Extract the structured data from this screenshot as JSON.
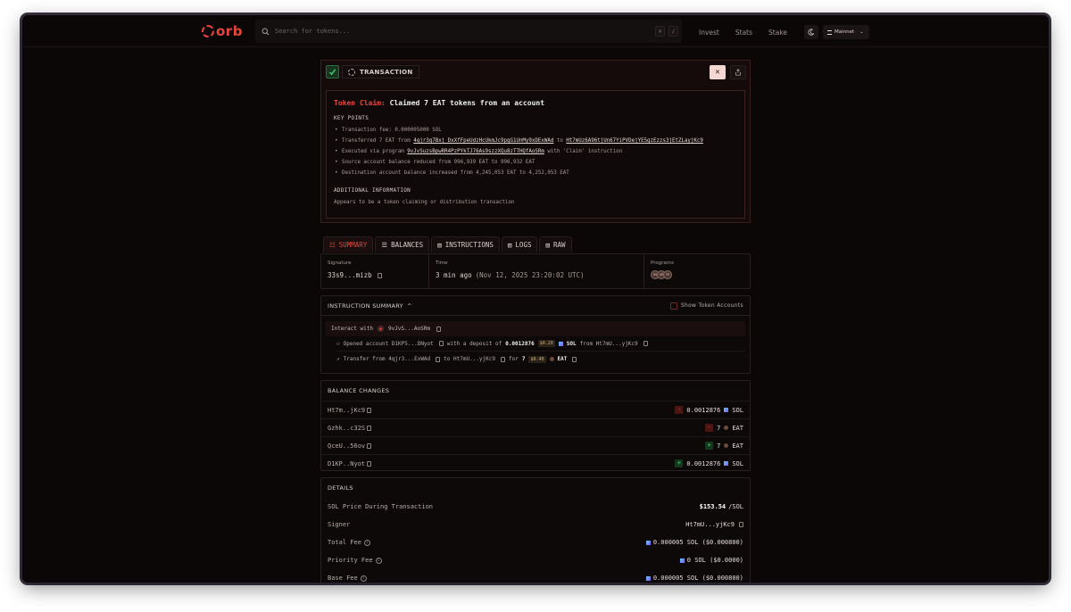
{
  "nav": {
    "logo": "orb",
    "search_placeholder": "Search for tokens...",
    "kbd1": "⌘",
    "kbd2": "/",
    "links": [
      "Invest",
      "Stats",
      "Stake"
    ],
    "network": "Mainnet"
  },
  "tx": {
    "tag": "TRANSACTION",
    "status_icon": "check-icon",
    "close_label": "✕",
    "summary_prefix": "Token Claim:",
    "summary_text": "Claimed 7 EAT tokens from an account",
    "key_points_label": "KEY POINTS",
    "bullets": [
      {
        "pre": "Transaction fee: 0.000005000 SOL",
        "link1": "",
        "mid": "",
        "link2": "",
        "post": ""
      },
      {
        "pre": "Transferred 7 EAT from ",
        "link1": "4qjr3g7Bxj DxXfFpeUdzHcUkmJc9pgG1UnMy9xDExWAd",
        "mid": " to ",
        "link2": "Ht7mUz6A96tjUn67YiPVDejYE5gzEzzs3jEtZLayjKc9",
        "post": ""
      },
      {
        "pre": "Executed via program ",
        "link1": "9vJvSuzsBpwRR4PzPYkTJ76As9szzXQu8zTTHQfAoSRm",
        "mid": " with 'Claim' instruction",
        "link2": "",
        "post": ""
      },
      {
        "pre": "Source account balance reduced from 996,939 EAT to 996,932 EAT",
        "link1": "",
        "mid": "",
        "link2": "",
        "post": ""
      },
      {
        "pre": "Destination account balance increased from 4,245,053 EAT to 4,252,053 EAT",
        "link1": "",
        "mid": "",
        "link2": "",
        "post": ""
      }
    ],
    "additional_label": "ADDITIONAL INFORMATION",
    "additional_text": "Appears to be a token claiming or distribution transaction"
  },
  "tabs": [
    "SUMMARY",
    "BALANCES",
    "INSTRUCTIONS",
    "LOGS",
    "RAW"
  ],
  "info": {
    "signature_label": "Signature",
    "signature": "33s9...mizb",
    "time_label": "Time",
    "time_rel": "3 min ago",
    "time_abs": "(Nov 12, 2025 23:20:02 UTC)",
    "programs_label": "Programs",
    "programs": [
      "9V",
      "SP",
      "TP"
    ]
  },
  "instructions": {
    "title": "INSTRUCTION SUMMARY",
    "toggle_label": "Show Token Accounts",
    "interact_prefix": "Interact with",
    "interact_program": "9vJvS...AoSRm",
    "row1": {
      "text": "Opened account D1KP5...DNyot",
      "with": "with a deposit of",
      "amount": "0.0012876",
      "usd": "$0.20",
      "token": "SOL",
      "from": "from Ht7mU...yjKc9"
    },
    "row2": {
      "text": "Transfer from 4qjr3...ExWAd",
      "to": "to Ht7mU...yjKc9",
      "for": "for",
      "amount": "7",
      "usd": "$0.40",
      "token": "EAT"
    }
  },
  "balances": {
    "title": "BALANCE CHANGES",
    "rows": [
      {
        "account": "Ht7m..jKc9",
        "sign": "-",
        "amount": "0.0012876",
        "token": "SOL"
      },
      {
        "account": "Gzhk..c32S",
        "sign": "-",
        "amount": "7",
        "token": "EAT"
      },
      {
        "account": "QceU..56ov",
        "sign": "+",
        "amount": "7",
        "token": "EAT"
      },
      {
        "account": "D1KP..Nyot",
        "sign": "+",
        "amount": "0.0012876",
        "token": "SOL"
      }
    ]
  },
  "details": {
    "title": "DETAILS",
    "rows": [
      {
        "label": "SOL Price During Transaction",
        "value_bold": "$153.54",
        "value": "/SOL"
      },
      {
        "label": "Signer",
        "value_bold": "",
        "value": "Ht7mU...yjKc9"
      },
      {
        "label": "Total Fee",
        "value_bold": "",
        "value": "0.000005 SOL ($0.000800)"
      },
      {
        "label": "Priority Fee",
        "value_bold": "",
        "value": "0 SOL ($0.0000)"
      },
      {
        "label": "Base Fee",
        "value_bold": "",
        "value": "0.000005 SOL ($0.000800)"
      }
    ]
  }
}
